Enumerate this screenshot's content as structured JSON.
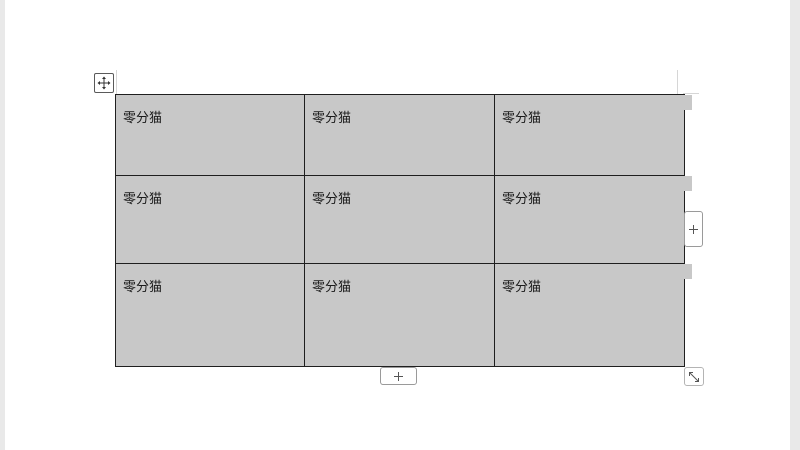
{
  "table": {
    "rows": [
      [
        "零分猫",
        "零分猫",
        "零分猫"
      ],
      [
        "零分猫",
        "零分猫",
        "零分猫"
      ],
      [
        "零分猫",
        "零分猫",
        "零分猫"
      ]
    ],
    "cell_fill_color": "#c8c8c8",
    "border_color": "#1f1f1f"
  },
  "controls": {
    "move_handle_icon": "move-arrows-icon",
    "add_column_icon": "plus-icon",
    "add_row_icon": "plus-icon",
    "resize_icon": "diagonal-resize-icon"
  },
  "colors": {
    "page_background": "#ffffff",
    "workspace_background": "#e9e9e9",
    "handle_border": "#9a9a9a"
  }
}
